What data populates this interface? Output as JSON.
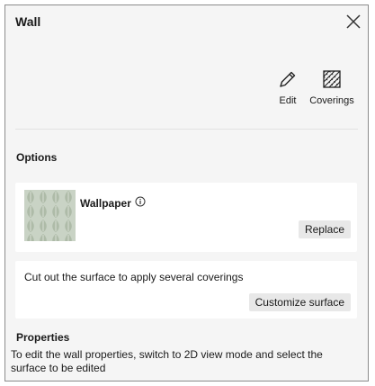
{
  "panel": {
    "title": "Wall"
  },
  "toolbar": {
    "edit_label": "Edit",
    "coverings_label": "Coverings"
  },
  "options": {
    "title": "Options",
    "covering": {
      "name": "Wallpaper",
      "replace_label": "Replace",
      "swatch_colors": [
        "#c9d3c5",
        "#aebba8"
      ]
    },
    "customize": {
      "text": "Cut out the surface to apply several coverings",
      "button_label": "Customize surface"
    }
  },
  "properties": {
    "title": "Properties",
    "text": "To edit the wall properties, switch to 2D view mode and select the surface to be edited"
  },
  "colors": {
    "panel_bg": "#f5f5f5",
    "card_bg": "#ffffff",
    "button_bg": "#e8e8e8",
    "border": "#8c8c8c"
  }
}
